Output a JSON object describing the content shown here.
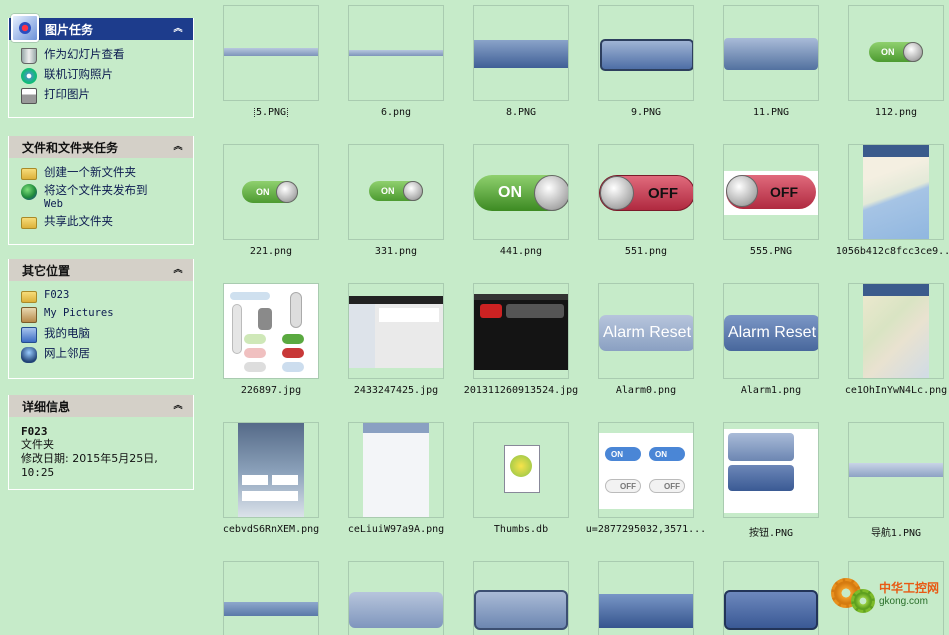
{
  "sidebar": {
    "picture_tasks": {
      "title": "图片任务",
      "items": [
        "作为幻灯片查看",
        "联机订购照片",
        "打印图片"
      ]
    },
    "file_tasks": {
      "title": "文件和文件夹任务",
      "items": [
        "创建一个新文件夹",
        "将这个文件夹发布到",
        "Web",
        "共享此文件夹"
      ]
    },
    "other_places": {
      "title": "其它位置",
      "items": [
        "F023",
        "My Pictures",
        "我的电脑",
        "网上邻居"
      ]
    },
    "details": {
      "title": "详细信息",
      "name": "F023",
      "type": "文件夹",
      "modified": "修改日期: 2015年5月25日,",
      "time": "10:25"
    }
  },
  "files": [
    {
      "name": "5.PNG"
    },
    {
      "name": "6.png"
    },
    {
      "name": "8.PNG"
    },
    {
      "name": "9.PNG"
    },
    {
      "name": "11.PNG"
    },
    {
      "name": "112.png"
    },
    {
      "name": "221.png"
    },
    {
      "name": "331.png"
    },
    {
      "name": "441.png"
    },
    {
      "name": "551.png"
    },
    {
      "name": "555.PNG"
    },
    {
      "name": "1056b412c8fcc3ce9..."
    },
    {
      "name": "226897.jpg"
    },
    {
      "name": "2433247425.jpg"
    },
    {
      "name": "201311260913524.jpg"
    },
    {
      "name": "Alarm0.png"
    },
    {
      "name": "Alarm1.png"
    },
    {
      "name": "ce1OhInYwN4Lc.png"
    },
    {
      "name": "cebvdS6RnXEM.png"
    },
    {
      "name": "ceLiuiW97a9A.png"
    },
    {
      "name": "Thumbs.db"
    },
    {
      "name": "u=2877295032,3571..."
    },
    {
      "name": "按钮.PNG"
    },
    {
      "name": "导航1.PNG"
    },
    {
      "name": ""
    },
    {
      "name": ""
    },
    {
      "name": ""
    },
    {
      "name": ""
    },
    {
      "name": ""
    },
    {
      "name": ""
    }
  ],
  "thumb_text": {
    "on": "ON",
    "off": "OFF",
    "alarm": "Alarm Reset"
  },
  "watermark": {
    "cn": "中华工控网",
    "en": "gkong.com"
  },
  "colors": {
    "background": "#c6ebc9",
    "pane_header_blue": "#1d3c8c",
    "pane_header_gray": "#d4d0c8"
  }
}
